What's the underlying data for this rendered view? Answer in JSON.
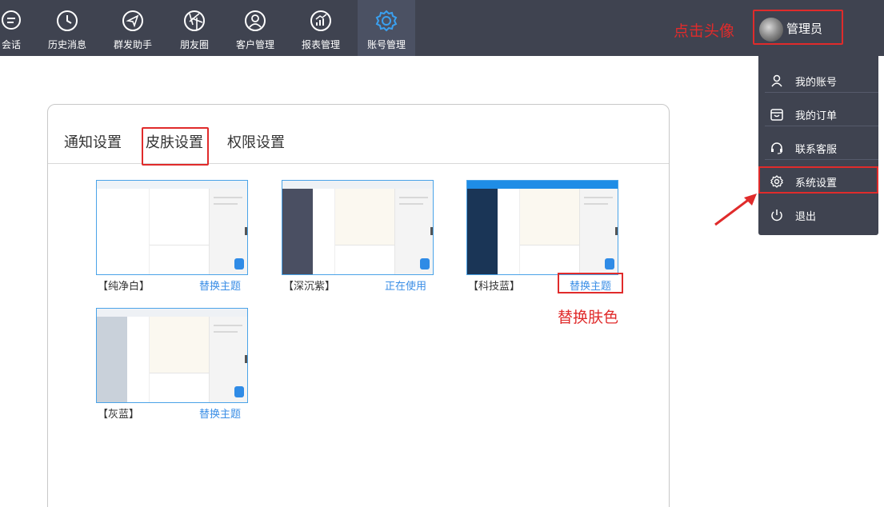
{
  "nav": {
    "items": [
      {
        "label": "会话",
        "icon": "chat-bubble-icon"
      },
      {
        "label": "历史消息",
        "icon": "clock-icon"
      },
      {
        "label": "群发助手",
        "icon": "paper-plane-icon"
      },
      {
        "label": "朋友圈",
        "icon": "aperture-icon"
      },
      {
        "label": "客户管理",
        "icon": "user-circle-icon"
      },
      {
        "label": "报表管理",
        "icon": "chart-icon"
      },
      {
        "label": "账号管理",
        "icon": "gear-icon"
      }
    ],
    "active_index": 6
  },
  "header": {
    "avatar_hint": "点击头像",
    "admin_name": "管理员"
  },
  "dropdown": {
    "items": [
      {
        "label": "我的账号",
        "icon": "user-icon"
      },
      {
        "label": "我的订单",
        "icon": "order-box-icon"
      },
      {
        "label": "联系客服",
        "icon": "headset-icon"
      },
      {
        "label": "系统设置",
        "icon": "gear-icon"
      },
      {
        "label": "退出",
        "icon": "power-icon"
      }
    ]
  },
  "settings": {
    "tabs": [
      "通知设置",
      "皮肤设置",
      "权限设置"
    ],
    "active_tab": "皮肤设置",
    "themes": [
      {
        "name": "【纯净白】",
        "action": "替换主题",
        "top_color": "#eef3f8",
        "side_color": "#ffffff",
        "chat_color": "#ffffff"
      },
      {
        "name": "【深沉紫】",
        "action": "正在使用",
        "top_color": "#eef1f5",
        "side_color": "#4a4f62",
        "chat_color": "#fbf8f0"
      },
      {
        "name": "【科技蓝】",
        "action": "替换主题",
        "top_color": "#1f8de6",
        "side_color": "#1a3556",
        "chat_color": "#fbf8f0"
      },
      {
        "name": "【灰蓝】",
        "action": "替换主题",
        "top_color": "#eef1f5",
        "side_color": "#c9d1da",
        "chat_color": "#fbf8f0"
      }
    ],
    "skin_hint": "替换肤色"
  },
  "colors": {
    "topbar": "#3f4350",
    "accent_blue": "#3a8ee6",
    "annotation_red": "#e02b2b"
  }
}
